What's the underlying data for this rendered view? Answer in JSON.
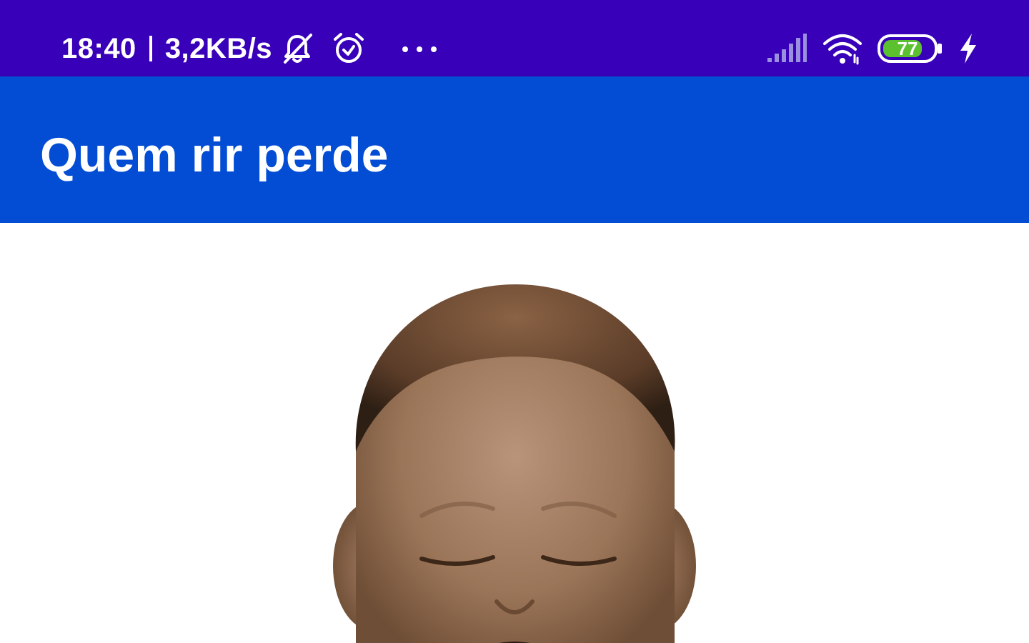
{
  "status_bar": {
    "time": "18:40",
    "network_speed": "3,2KB/s",
    "battery_level": "77",
    "icons": {
      "mute": "bell-off-icon",
      "alarm": "alarm-clock-icon",
      "more": "more-dots-icon",
      "signal": "signal-strength-icon",
      "wifi": "wifi-icon",
      "battery": "battery-icon",
      "charging": "charging-bolt-icon"
    },
    "colors": {
      "background": "#3800b8",
      "battery_fill": "#5cc12f"
    }
  },
  "app_bar": {
    "title": "Quem rir perde",
    "background": "#024dd3"
  },
  "content": {
    "image": "laughing-baby-illustration"
  }
}
